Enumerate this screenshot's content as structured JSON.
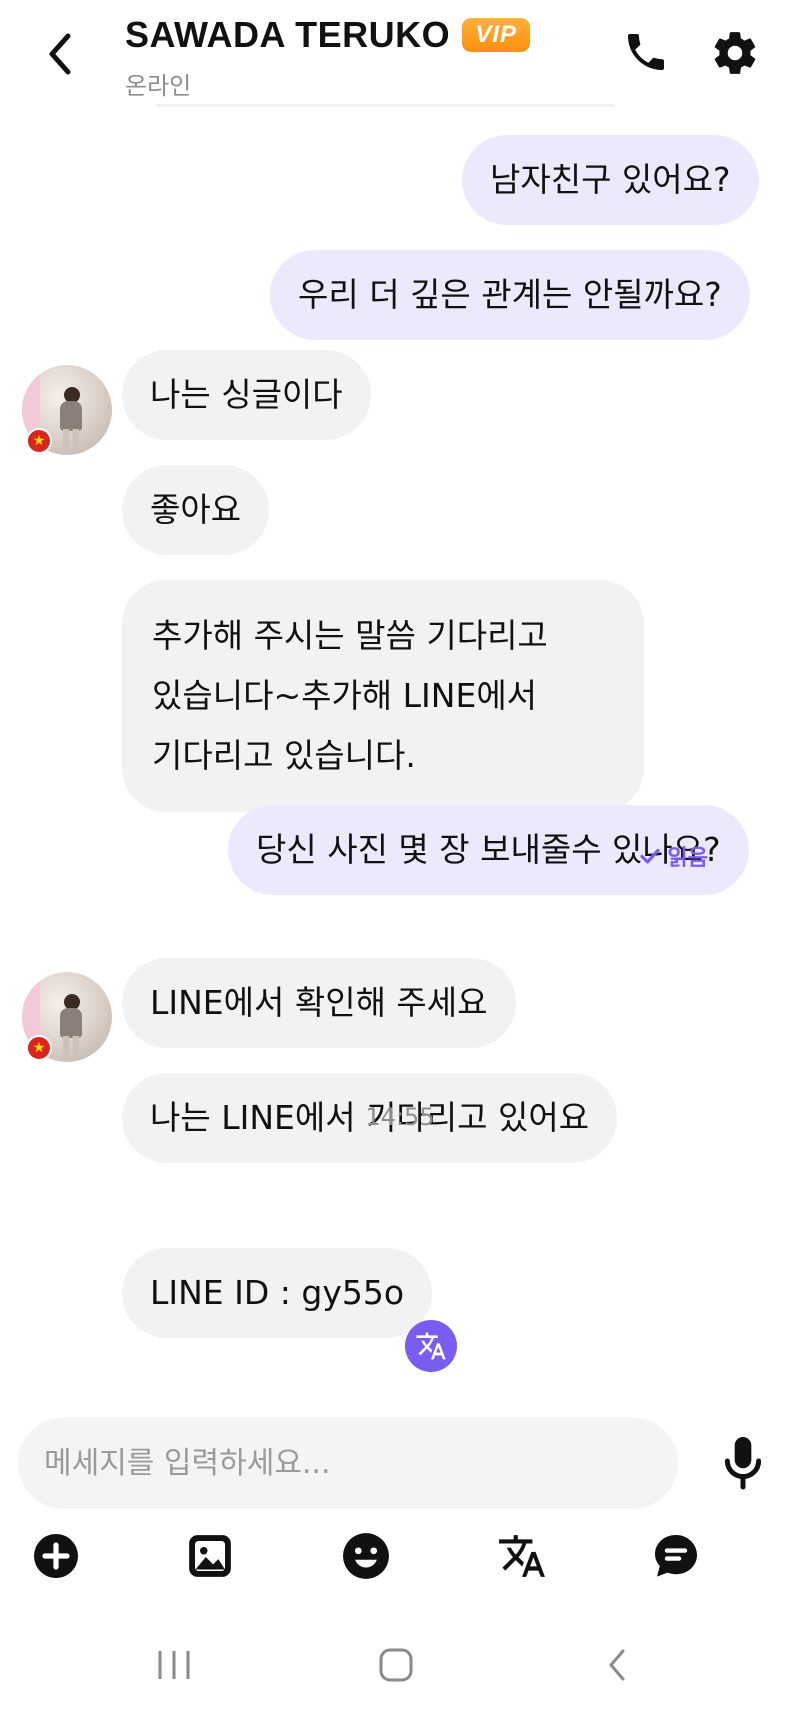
{
  "header": {
    "title": "SAWADA TERUKO",
    "badge": "VIP",
    "status": "온라인"
  },
  "messages": [
    {
      "dir": "out",
      "text": "남자친구 있어요?"
    },
    {
      "dir": "out",
      "text": "우리 더 깊은 관계는 안될까요?"
    },
    {
      "dir": "in",
      "text": "나는 싱글이다"
    },
    {
      "dir": "in",
      "text": "좋아요"
    },
    {
      "dir": "in",
      "lines": [
        "추가해 주시는 말씀 기다리고",
        "있습니다~추가해 LINE에서",
        "기다리고 있습니다."
      ]
    },
    {
      "dir": "out",
      "text": "당신 사진 몇 장 보내줄수 있나요?"
    },
    {
      "dir": "in",
      "text": "LINE에서 확인해 주세요"
    },
    {
      "dir": "in",
      "text": "나는 LINE에서 기다리고 있어요"
    },
    {
      "dir": "in",
      "text": "LINE ID : gy55o"
    }
  ],
  "read_receipt": "읽음",
  "timestamp": "14:55",
  "input": {
    "placeholder": "메세지를 입력하세요...",
    "value": ""
  },
  "colors": {
    "accent": "#7b5cf0",
    "out_bubble": "#ece9fd",
    "in_bubble": "#f2f2f4",
    "vip": "#ff9a1f"
  },
  "icons": {
    "back": "chevron-left-icon",
    "call": "phone-icon",
    "settings": "gear-icon",
    "translate": "translate-icon",
    "mic": "microphone-icon",
    "add": "plus-circle-icon",
    "image": "image-icon",
    "emoji": "smiley-icon",
    "chat": "chat-bubble-icon"
  }
}
